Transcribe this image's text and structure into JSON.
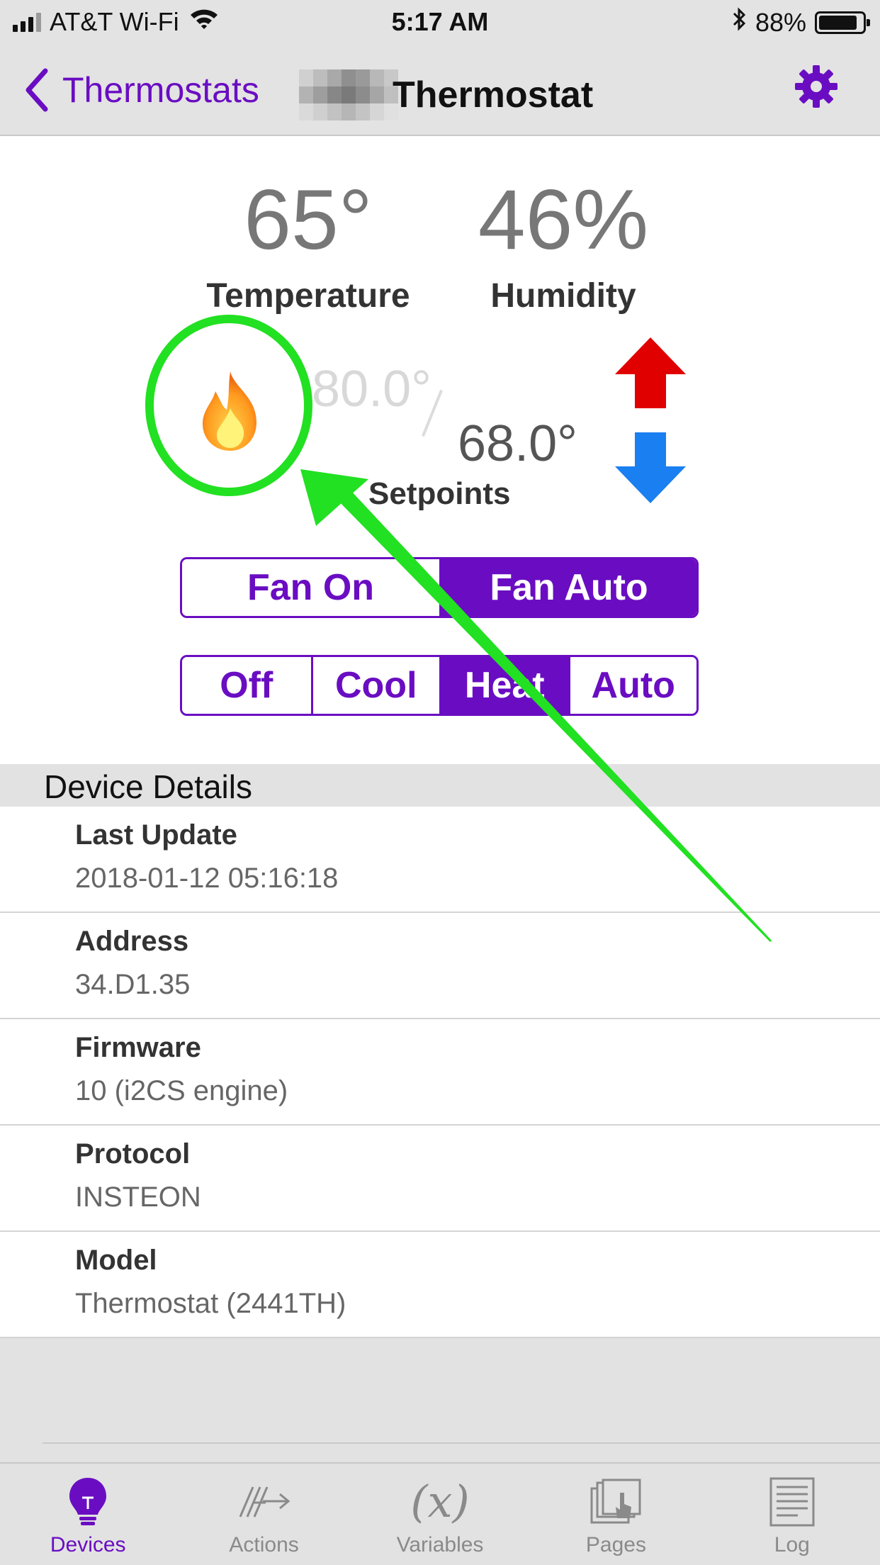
{
  "status_bar": {
    "carrier": "AT&T Wi-Fi",
    "time": "5:17 AM",
    "battery": "88%",
    "battery_level": 0.88
  },
  "nav": {
    "back_label": "Thermostats",
    "title": "Thermostat"
  },
  "readings": {
    "temperature_value": "65°",
    "temperature_label": "Temperature",
    "humidity_value": "46%",
    "humidity_label": "Humidity"
  },
  "setpoints": {
    "cool": "80.0°",
    "heat": "68.0°",
    "label": "Setpoints"
  },
  "fan_mode": {
    "options": [
      "Fan On",
      "Fan Auto"
    ],
    "selected": "Fan Auto"
  },
  "hvac_mode": {
    "options": [
      "Off",
      "Cool",
      "Heat",
      "Auto"
    ],
    "selected": "Heat"
  },
  "details": {
    "header": "Device Details",
    "rows": [
      {
        "label": "Last Update",
        "value": "2018-01-12 05:16:18"
      },
      {
        "label": "Address",
        "value": "34.D1.35"
      },
      {
        "label": "Firmware",
        "value": "10 (i2CS engine)"
      },
      {
        "label": "Protocol",
        "value": "INSTEON"
      },
      {
        "label": "Model",
        "value": "Thermostat (2441TH)"
      }
    ]
  },
  "tabs": [
    {
      "label": "Devices",
      "icon": "lightbulb-icon",
      "active": true
    },
    {
      "label": "Actions",
      "icon": "actions-icon",
      "active": false
    },
    {
      "label": "Variables",
      "icon": "variable-x-icon",
      "active": false
    },
    {
      "label": "Pages",
      "icon": "pages-icon",
      "active": false
    },
    {
      "label": "Log",
      "icon": "log-icon",
      "active": false
    }
  ],
  "colors": {
    "accent": "#6a0dc2",
    "up_arrow": "#e00000",
    "down_arrow": "#1a7ff0",
    "annotation": "#22e022"
  }
}
